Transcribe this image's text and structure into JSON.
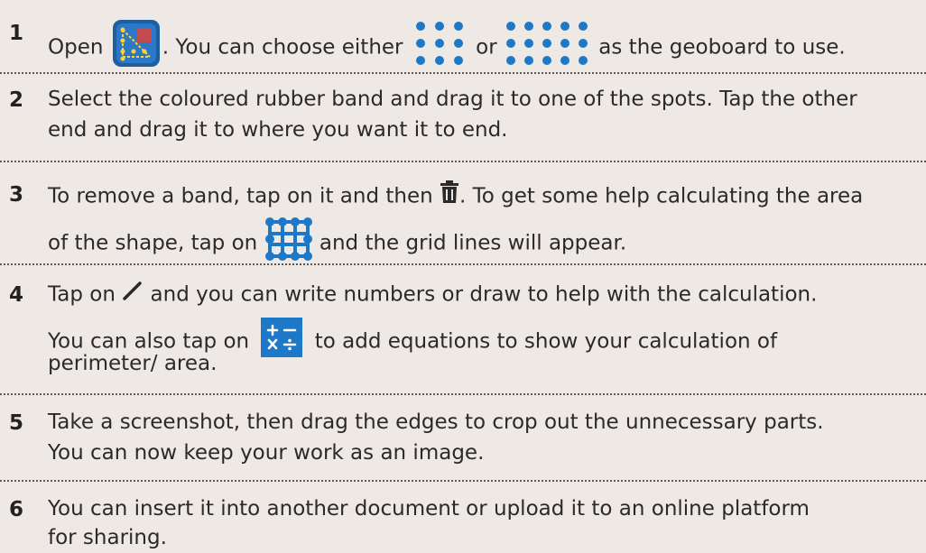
{
  "steps": [
    {
      "number": "1",
      "part_open": "Open",
      "part_choose": ". You can choose either",
      "part_or": "or",
      "part_end": "as the geoboard to use.",
      "icons": [
        "geoboard-app-icon",
        "dot-grid-3x3-icon",
        "dot-grid-5x3-icon"
      ]
    },
    {
      "number": "2",
      "line1": "Select the coloured rubber band and drag it to one of the spots. Tap the other",
      "line2": "end and drag it to where you want it to end."
    },
    {
      "number": "3",
      "part_remove": "To remove a band, tap on it and then",
      "part_help": ". To get some help calculating the area",
      "line2_start": "of the shape, tap on",
      "line2_end": "and the grid lines will appear.",
      "icons": [
        "trash-icon",
        "grid-lines-icon"
      ]
    },
    {
      "number": "4",
      "part_tap": "Tap on",
      "part_write": "and you can write numbers or draw to help with the calculation.",
      "line2_start": "You can also tap on",
      "line2_end": "to add equations to show your calculation of",
      "line3": "perimeter/ area.",
      "icons": [
        "pencil-icon",
        "math-operators-icon"
      ]
    },
    {
      "number": "5",
      "line1": "Take a screenshot, then drag the edges to crop out the unnecessary parts.",
      "line2": "You can now keep your work as an image."
    },
    {
      "number": "6",
      "line1": "You can insert it into another document or upload it to an online platform",
      "line2": "for sharing."
    }
  ],
  "colors": {
    "background": "#efe9e6",
    "accent_blue": "#1e78c8",
    "text": "#2a2a2a"
  }
}
